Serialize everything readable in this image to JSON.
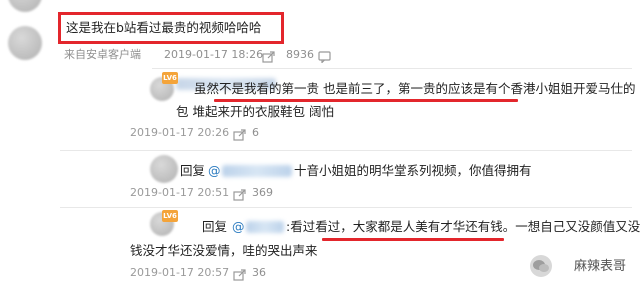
{
  "comments": [
    {
      "text": "这是我在b站看过最贵的视频哈哈哈",
      "source": "来自安卓客户端",
      "date": "2019-01-17 18:26",
      "share_count": "8936"
    },
    {
      "badge": "LV6",
      "line1": "虽然不是我看的第一贵 也是前三了，第一贵的应该是有个香港小姐姐开爱马仕的",
      "line2": "包 堆起来开的衣服鞋包 阔怕",
      "date": "2019-01-17 20:26",
      "like_count": "6"
    },
    {
      "reply_label": "回复",
      "at": "@",
      "text": "十音小姐姐的明华堂系列视频，你值得拥有",
      "date": "2019-01-17 20:51",
      "like_count": "369"
    },
    {
      "badge": "LV6",
      "reply_label": "回复",
      "at": "@",
      "line1": ":看过看过，大家都是人美有才华还有钱。一想自己又没颜值又没",
      "line2": "钱没才华还没爱情，哇的哭出声来",
      "date": "2019-01-17 20:57",
      "like_count": "36"
    }
  ],
  "watermark": "麻辣表哥",
  "colors": {
    "highlight": "#e3262c",
    "mention": "#2b7bc0",
    "badge": "#f4a43a"
  }
}
